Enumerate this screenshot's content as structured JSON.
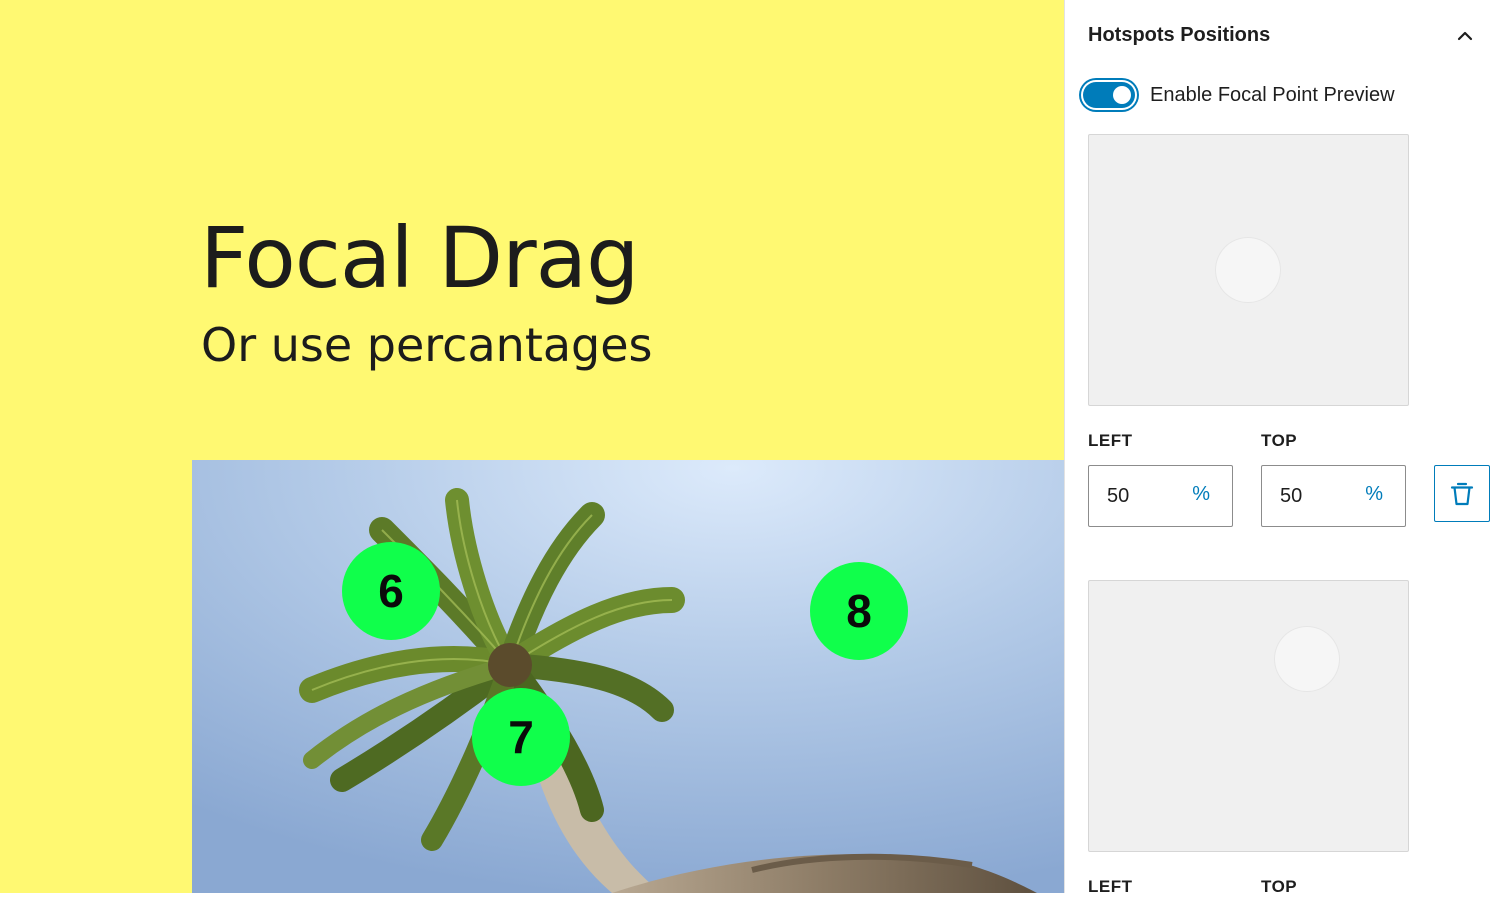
{
  "canvas": {
    "heading": "Focal Drag",
    "subheading": "Or use percantages",
    "hotspots": [
      {
        "label": "6"
      },
      {
        "label": "7"
      },
      {
        "label": "8"
      }
    ]
  },
  "sidebar": {
    "panel_title": "Hotspots Positions",
    "toggle": {
      "label": "Enable Focal Point Preview",
      "checked": true
    },
    "hotspots": [
      {
        "left_label": "LEFT",
        "top_label": "TOP",
        "left": "50",
        "top": "50",
        "unit": "%"
      },
      {
        "left_label": "LEFT",
        "top_label": "TOP",
        "left": "",
        "top": "",
        "unit": "%"
      }
    ]
  },
  "icons": {
    "collapse": "chevron-up-icon",
    "delete": "trash-icon"
  },
  "colors": {
    "canvas_bg": "#fff972",
    "hotspot": "#10ff4b",
    "accent": "#007cba",
    "preview_bg": "#f0f0f0"
  }
}
